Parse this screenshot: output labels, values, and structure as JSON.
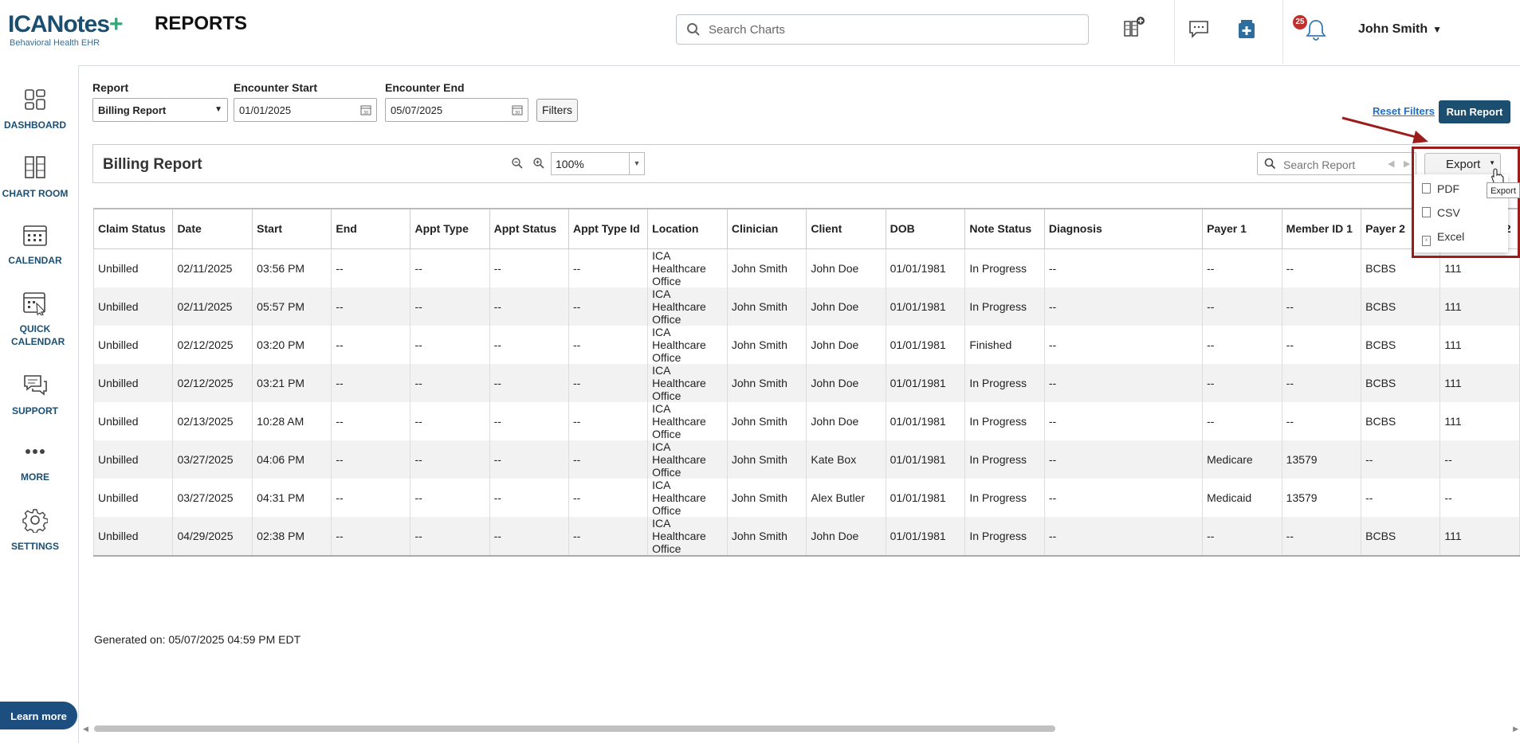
{
  "header": {
    "logo_text": "ICANotes",
    "logo_plus": "+",
    "logo_sub": "Behavioral Health EHR",
    "page_title": "REPORTS",
    "search_placeholder": "Search Charts",
    "notification_count": "25",
    "user_name": "John Smith"
  },
  "sidebar": {
    "items": [
      {
        "label": "DASHBOARD",
        "icon": "dashboard-icon"
      },
      {
        "label": "CHART ROOM",
        "icon": "chart-room-icon"
      },
      {
        "label": "CALENDAR",
        "icon": "calendar-icon"
      },
      {
        "label": "QUICK CALENDAR",
        "icon": "quick-calendar-icon"
      },
      {
        "label": "SUPPORT",
        "icon": "support-icon"
      },
      {
        "label": "MORE",
        "icon": "more-icon"
      },
      {
        "label": "SETTINGS",
        "icon": "settings-icon"
      }
    ],
    "learn_more": "Learn more"
  },
  "filters": {
    "report_label": "Report",
    "report_value": "Billing Report",
    "start_label": "Encounter Start",
    "start_value": "01/01/2025",
    "end_label": "Encounter End",
    "end_value": "05/07/2025",
    "filters_button": "Filters",
    "reset_filters": "Reset Filters",
    "run_report": "Run Report"
  },
  "viewer": {
    "title": "Billing Report",
    "zoom": "100%",
    "search_placeholder": "Search Report",
    "export_label": "Export",
    "export_menu": [
      "PDF",
      "CSV",
      "Excel"
    ],
    "tooltip": "Export"
  },
  "table": {
    "columns": [
      "Claim Status",
      "Date",
      "Start",
      "End",
      "Appt Type",
      "Appt Status",
      "Appt Type Id",
      "Location",
      "Clinician",
      "Client",
      "DOB",
      "Note Status",
      "Diagnosis",
      "Payer 1",
      "Member ID 1",
      "Payer 2",
      "Member ID 2"
    ],
    "rows": [
      [
        "Unbilled",
        "02/11/2025",
        "03:56 PM",
        "--",
        "--",
        "--",
        "--",
        "ICA Healthcare Office",
        "John Smith",
        "John Doe",
        "01/01/1981",
        "In Progress",
        "--",
        "--",
        "--",
        "BCBS",
        "111"
      ],
      [
        "Unbilled",
        "02/11/2025",
        "05:57 PM",
        "--",
        "--",
        "--",
        "--",
        "ICA Healthcare Office",
        "John Smith",
        "John Doe",
        "01/01/1981",
        "In Progress",
        "--",
        "--",
        "--",
        "BCBS",
        "111"
      ],
      [
        "Unbilled",
        "02/12/2025",
        "03:20 PM",
        "--",
        "--",
        "--",
        "--",
        "ICA Healthcare Office",
        "John Smith",
        "John Doe",
        "01/01/1981",
        "Finished",
        "--",
        "--",
        "--",
        "BCBS",
        "111"
      ],
      [
        "Unbilled",
        "02/12/2025",
        "03:21 PM",
        "--",
        "--",
        "--",
        "--",
        "ICA Healthcare Office",
        "John Smith",
        "John Doe",
        "01/01/1981",
        "In Progress",
        "--",
        "--",
        "--",
        "BCBS",
        "111"
      ],
      [
        "Unbilled",
        "02/13/2025",
        "10:28 AM",
        "--",
        "--",
        "--",
        "--",
        "ICA Healthcare Office",
        "John Smith",
        "John Doe",
        "01/01/1981",
        "In Progress",
        "--",
        "--",
        "--",
        "BCBS",
        "111"
      ],
      [
        "Unbilled",
        "03/27/2025",
        "04:06 PM",
        "--",
        "--",
        "--",
        "--",
        "ICA Healthcare Office",
        "John Smith",
        "Kate Box",
        "01/01/1981",
        "In Progress",
        "--",
        "Medicare",
        "13579",
        "--",
        "--"
      ],
      [
        "Unbilled",
        "03/27/2025",
        "04:31 PM",
        "--",
        "--",
        "--",
        "--",
        "ICA Healthcare Office",
        "John Smith",
        "Alex Butler",
        "01/01/1981",
        "In Progress",
        "--",
        "Medicaid",
        "13579",
        "--",
        "--"
      ],
      [
        "Unbilled",
        "04/29/2025",
        "02:38 PM",
        "--",
        "--",
        "--",
        "--",
        "ICA Healthcare Office",
        "John Smith",
        "John Doe",
        "01/01/1981",
        "In Progress",
        "--",
        "--",
        "--",
        "BCBS",
        "111"
      ]
    ]
  },
  "footer": {
    "generated": "Generated on: 05/07/2025 04:59 PM EDT"
  },
  "colors": {
    "brand": "#1b4f72",
    "run_button": "#1c4e6f",
    "highlight": "#9c1c1c",
    "badge": "#c0302f"
  }
}
